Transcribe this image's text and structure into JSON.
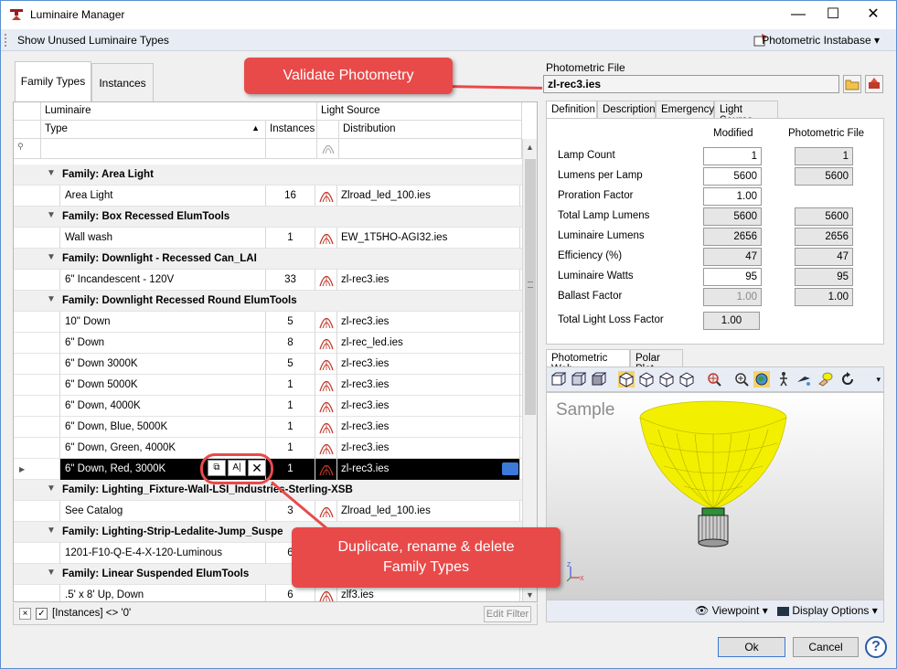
{
  "window": {
    "title": "Luminaire Manager"
  },
  "menubar": {
    "show_unused": "Show Unused Luminaire Types",
    "instabase": "Photometric Instabase",
    "instabase_arrow": "▾"
  },
  "tabs": [
    "Family Types",
    "Instances"
  ],
  "grid": {
    "group_headers": {
      "luminaire": "Luminaire",
      "light_source": "Light Source"
    },
    "columns": {
      "type": "Type",
      "instances": "Instances",
      "distribution": "Distribution"
    },
    "rows": [
      {
        "kind": "group",
        "label": "Family:  Area Light"
      },
      {
        "kind": "item",
        "type": "Area Light",
        "instances": "16",
        "distribution": "Zlroad_led_100.ies"
      },
      {
        "kind": "group",
        "label": "Family:  Box Recessed ElumTools"
      },
      {
        "kind": "item",
        "type": "Wall wash",
        "instances": "1",
        "distribution": "EW_1T5HO-AGI32.ies"
      },
      {
        "kind": "group",
        "label": "Family:  Downlight - Recessed Can_LAI"
      },
      {
        "kind": "item",
        "type": "6\" Incandescent - 120V",
        "instances": "33",
        "distribution": "zl-rec3.ies"
      },
      {
        "kind": "group",
        "label": "Family:  Downlight Recessed Round ElumTools"
      },
      {
        "kind": "item",
        "type": "10\" Down",
        "instances": "5",
        "distribution": "zl-rec3.ies"
      },
      {
        "kind": "item",
        "type": "6\" Down",
        "instances": "8",
        "distribution": "zl-rec_led.ies"
      },
      {
        "kind": "item",
        "type": "6\" Down 3000K",
        "instances": "5",
        "distribution": "zl-rec3.ies"
      },
      {
        "kind": "item",
        "type": "6\" Down 5000K",
        "instances": "1",
        "distribution": "zl-rec3.ies"
      },
      {
        "kind": "item",
        "type": "6\" Down, 4000K",
        "instances": "1",
        "distribution": "zl-rec3.ies"
      },
      {
        "kind": "item",
        "type": "6\" Down, Blue, 5000K",
        "instances": "1",
        "distribution": "zl-rec3.ies"
      },
      {
        "kind": "item",
        "type": "6\" Down, Green, 4000K",
        "instances": "1",
        "distribution": "zl-rec3.ies"
      },
      {
        "kind": "item",
        "type": "6\" Down, Red, 3000K",
        "instances": "1",
        "distribution": "zl-rec3.ies",
        "selected": true
      },
      {
        "kind": "group",
        "label": "Family:  Lighting_Fixture-Wall-LSI_Industries-Sterling-XSB"
      },
      {
        "kind": "item",
        "type": "See Catalog",
        "instances": "3",
        "distribution": "Zlroad_led_100.ies"
      },
      {
        "kind": "group",
        "label": "Family:  Lighting-Strip-Ledalite-Jump_Suspe"
      },
      {
        "kind": "item",
        "type": "1201-F10-Q-E-4-X-120-Luminous",
        "instances": "6",
        "distribution": ""
      },
      {
        "kind": "group",
        "label": "Family:  Linear Suspended ElumTools"
      },
      {
        "kind": "item",
        "type": ".5' x 8' Up, Down",
        "instances": "6",
        "distribution": "zlf3.ies"
      }
    ]
  },
  "footer": {
    "filter_text": "[Instances] <> '0'",
    "edit_filter": "Edit Filter",
    "close_x": "×",
    "check": "✓"
  },
  "photometric_file": {
    "label": "Photometric File",
    "value": "zl-rec3.ies"
  },
  "right_tabs": [
    "Definition",
    "Description",
    "Emergency",
    "Light Source"
  ],
  "definition": {
    "col_modified": "Modified",
    "col_file": "Photometric File",
    "rows": [
      {
        "label": "Lamp Count",
        "modified": "1",
        "file": "1",
        "mod_state": "edit",
        "file_state": "ro"
      },
      {
        "label": "Lumens per Lamp",
        "modified": "5600",
        "file": "5600",
        "mod_state": "edit",
        "file_state": "ro"
      },
      {
        "label": "Proration Factor",
        "modified": "1.00",
        "file": "",
        "mod_state": "edit",
        "file_state": "none"
      },
      {
        "label": "Total Lamp Lumens",
        "modified": "5600",
        "file": "5600",
        "mod_state": "ro",
        "file_state": "ro"
      },
      {
        "label": "Luminaire Lumens",
        "modified": "2656",
        "file": "2656",
        "mod_state": "ro",
        "file_state": "ro"
      },
      {
        "label": "Efficiency (%)",
        "modified": "47",
        "file": "47",
        "mod_state": "ro",
        "file_state": "ro"
      },
      {
        "label": "Luminaire Watts",
        "modified": "95",
        "file": "95",
        "mod_state": "edit",
        "file_state": "ro"
      },
      {
        "label": "Ballast Factor",
        "modified": "1.00",
        "file": "1.00",
        "mod_state": "dis",
        "file_state": "ro"
      }
    ],
    "tllf_label": "Total Light Loss Factor",
    "tllf_value": "1.00"
  },
  "photometric_tabs": [
    "Photometric Web",
    "Polar Plot"
  ],
  "viewer": {
    "sample": "Sample",
    "viewpoint": "Viewpoint",
    "display_options": "Display Options",
    "axis_z": "Z",
    "axis_x": "X"
  },
  "buttons": {
    "ok": "Ok",
    "cancel": "Cancel",
    "help": "?"
  },
  "callouts": {
    "validate": "Validate Photometry",
    "duplicate_line1": "Duplicate, rename & delete",
    "duplicate_line2": "Family Types"
  },
  "colors": {
    "callout": "#e84a4a",
    "selected_row": "#000000",
    "bulb": "#f2ef00"
  }
}
